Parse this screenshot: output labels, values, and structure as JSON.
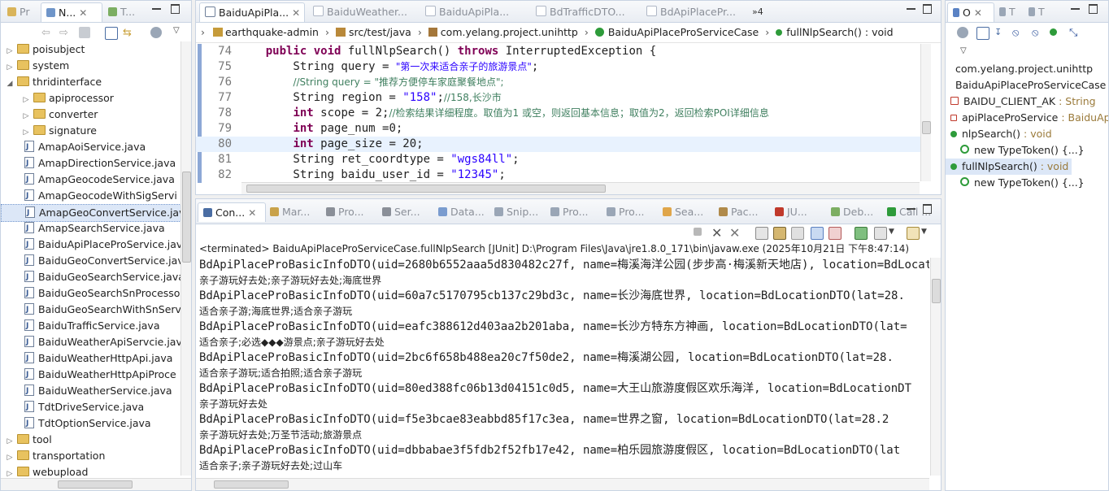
{
  "left_tabs": [
    {
      "label": "Pr",
      "active": false
    },
    {
      "label": "N...",
      "active": true
    },
    {
      "label": "T...",
      "active": false
    }
  ],
  "tree": [
    {
      "label": "poisubject",
      "kind": "folder",
      "indent": 0,
      "expanded": false
    },
    {
      "label": "system",
      "kind": "folder",
      "indent": 0,
      "expanded": false
    },
    {
      "label": "thridinterface",
      "kind": "folder",
      "indent": 0,
      "expanded": true
    },
    {
      "label": "apiprocessor",
      "kind": "folder",
      "indent": 1,
      "expanded": false
    },
    {
      "label": "converter",
      "kind": "folder",
      "indent": 1,
      "expanded": false
    },
    {
      "label": "signature",
      "kind": "folder",
      "indent": 1,
      "expanded": false
    },
    {
      "label": "AmapAoiService.java",
      "kind": "file",
      "indent": 1
    },
    {
      "label": "AmapDirectionService.java",
      "kind": "file",
      "indent": 1
    },
    {
      "label": "AmapGeocodeService.java",
      "kind": "file",
      "indent": 1
    },
    {
      "label": "AmapGeocodeWithSigServi",
      "kind": "file",
      "indent": 1
    },
    {
      "label": "AmapGeoConvertService.jav",
      "kind": "file",
      "indent": 1,
      "selected": true
    },
    {
      "label": "AmapSearchService.java",
      "kind": "file",
      "indent": 1
    },
    {
      "label": "BaiduApiPlaceProService.jav",
      "kind": "file",
      "indent": 1
    },
    {
      "label": "BaiduGeoConvertService.java",
      "kind": "file",
      "indent": 1
    },
    {
      "label": "BaiduGeoSearchService.java",
      "kind": "file",
      "indent": 1
    },
    {
      "label": "BaiduGeoSearchSnProcesso",
      "kind": "file",
      "indent": 1
    },
    {
      "label": "BaiduGeoSearchWithSnServ",
      "kind": "file",
      "indent": 1
    },
    {
      "label": "BaiduTrafficService.java",
      "kind": "file",
      "indent": 1
    },
    {
      "label": "BaiduWeatherApiServcie.java",
      "kind": "file",
      "indent": 1
    },
    {
      "label": "BaiduWeatherHttpApi.java",
      "kind": "file",
      "indent": 1
    },
    {
      "label": "BaiduWeatherHttpApiProce",
      "kind": "file",
      "indent": 1
    },
    {
      "label": "BaiduWeatherService.java",
      "kind": "file",
      "indent": 1
    },
    {
      "label": "TdtDriveService.java",
      "kind": "file",
      "indent": 1
    },
    {
      "label": "TdtOptionService.java",
      "kind": "file",
      "indent": 1
    },
    {
      "label": "tool",
      "kind": "folder",
      "indent": 0,
      "expanded": false
    },
    {
      "label": "transportation",
      "kind": "folder",
      "indent": 0,
      "expanded": false
    },
    {
      "label": "webupload",
      "kind": "folder",
      "indent": 0,
      "expanded": false
    }
  ],
  "editor_tabs": [
    {
      "label": "BaiduApiPla...",
      "active": true
    },
    {
      "label": "BaiduWeather...",
      "active": false
    },
    {
      "label": "BaiduApiPla...",
      "active": false
    },
    {
      "label": "BdTrafficDTO...",
      "active": false
    },
    {
      "label": "BdApiPlacePr...",
      "active": false
    }
  ],
  "editor_overflow": "»4",
  "breadcrumb": [
    "earthquake-admin",
    "src/test/java",
    "com.yelang.project.unihttp",
    "BaiduApiPlaceProServiceCase",
    "fullNlpSearch() : void"
  ],
  "code_lines": [
    {
      "num": "74",
      "parts": [
        {
          "t": "    "
        },
        {
          "t": "public",
          "c": "kw"
        },
        {
          "t": " "
        },
        {
          "t": "void",
          "c": "kw"
        },
        {
          "t": " fullNlpSearch() "
        },
        {
          "t": "throws",
          "c": "kw"
        },
        {
          "t": " InterruptedException {"
        }
      ]
    },
    {
      "num": "75",
      "parts": [
        {
          "t": "        String query = "
        },
        {
          "t": "\"第一次来适合亲子的旅游景点\"",
          "c": "str"
        },
        {
          "t": ";"
        }
      ]
    },
    {
      "num": "76",
      "parts": [
        {
          "t": "        "
        },
        {
          "t": "//String query = \"推荐方便停车家庭聚餐地点\";",
          "c": "cmt"
        }
      ]
    },
    {
      "num": "77",
      "parts": [
        {
          "t": "        String region = "
        },
        {
          "t": "\"158\"",
          "c": "str"
        },
        {
          "t": ";"
        },
        {
          "t": "//158,长沙市",
          "c": "cmt"
        }
      ]
    },
    {
      "num": "78",
      "parts": [
        {
          "t": "        "
        },
        {
          "t": "int",
          "c": "kw"
        },
        {
          "t": " scope = 2;"
        },
        {
          "t": "//检索结果详细程度。取值为1 或空，则返回基本信息；取值为2，返回检索POI详细信息",
          "c": "cmt"
        }
      ]
    },
    {
      "num": "79",
      "parts": [
        {
          "t": "        "
        },
        {
          "t": "int",
          "c": "kw"
        },
        {
          "t": " page_num =0;"
        }
      ]
    },
    {
      "num": "80",
      "parts": [
        {
          "t": "        "
        },
        {
          "t": "int",
          "c": "kw"
        },
        {
          "t": " page_size = 20;"
        }
      ],
      "highlight": true
    },
    {
      "num": "81",
      "parts": [
        {
          "t": "        String ret_coordtype = "
        },
        {
          "t": "\"wgs84ll\"",
          "c": "str"
        },
        {
          "t": ";"
        }
      ]
    },
    {
      "num": "82",
      "parts": [
        {
          "t": "        String baidu_user_id = "
        },
        {
          "t": "\"12345\"",
          "c": "str"
        },
        {
          "t": ";"
        }
      ]
    }
  ],
  "console_tabs": [
    {
      "label": "Con...",
      "active": true
    },
    {
      "label": "Mar...",
      "active": false
    },
    {
      "label": "Pro...",
      "active": false
    },
    {
      "label": "Ser...",
      "active": false
    },
    {
      "label": "Data...",
      "active": false
    },
    {
      "label": "Snip...",
      "active": false
    },
    {
      "label": "Pro...",
      "active": false
    },
    {
      "label": "Pro...",
      "active": false
    },
    {
      "label": "Sea...",
      "active": false
    },
    {
      "label": "Pac...",
      "active": false
    },
    {
      "label": "JU...",
      "active": false
    },
    {
      "label": "Deb...",
      "active": false
    },
    {
      "label": "Call ...",
      "active": false
    }
  ],
  "console_status": "<terminated> BaiduApiPlaceProServiceCase.fullNlpSearch [JUnit] D:\\Program Files\\Java\\jre1.8.0_171\\bin\\javaw.exe  (2025年10月21日 下午8:47:14)",
  "console_lines": [
    {
      "text": "BdApiPlaceProBasicInfoDTO(uid=2680b6552aaa5d830482c27f, name=梅溪海洋公园(步步高·梅溪新天地店), location=BdLocat",
      "cjk": false
    },
    {
      "text": "亲子游玩好去处;亲子游玩好去处;海底世界",
      "cjk": true
    },
    {
      "text": "BdApiPlaceProBasicInfoDTO(uid=60a7c5170795cb137c29bd3c, name=长沙海底世界, location=BdLocationDTO(lat=28.",
      "cjk": false
    },
    {
      "text": "适合亲子游;海底世界;适合亲子游玩",
      "cjk": true
    },
    {
      "text": "BdApiPlaceProBasicInfoDTO(uid=eafc388612d403aa2b201aba, name=长沙方特东方神画, location=BdLocationDTO(lat=",
      "cjk": false
    },
    {
      "text": "适合亲子;必选◆◆◆游景点;亲子游玩好去处",
      "cjk": true
    },
    {
      "text": "BdApiPlaceProBasicInfoDTO(uid=2bc6f658b488ea20c7f50de2, name=梅溪湖公园, location=BdLocationDTO(lat=28.",
      "cjk": false
    },
    {
      "text": "适合亲子游玩;适合拍照;适合亲子游玩",
      "cjk": true
    },
    {
      "text": "BdApiPlaceProBasicInfoDTO(uid=80ed388fc06b13d04151c0d5, name=大王山旅游度假区欢乐海洋, location=BdLocationDT",
      "cjk": false
    },
    {
      "text": "亲子游玩好去处",
      "cjk": true
    },
    {
      "text": "BdApiPlaceProBasicInfoDTO(uid=f5e3bcae83eabbd85f17c3ea, name=世界之窗, location=BdLocationDTO(lat=28.2",
      "cjk": false
    },
    {
      "text": "亲子游玩好去处;万圣节活动;旅游景点",
      "cjk": true
    },
    {
      "text": "BdApiPlaceProBasicInfoDTO(uid=dbbabae3f5fdb2f52fb17e42, name=柏乐园旅游度假区, location=BdLocationDTO(lat",
      "cjk": false
    },
    {
      "text": "适合亲子;亲子游玩好去处;过山车",
      "cjk": true
    }
  ],
  "outline_tabs": [
    {
      "label": "O",
      "active": true
    },
    {
      "label": "T",
      "active": false
    },
    {
      "label": "T",
      "active": false
    }
  ],
  "outline": [
    {
      "label": "com.yelang.project.unihttp",
      "type": "",
      "kind": "package",
      "indent": 0
    },
    {
      "label": "BaiduApiPlaceProServiceCase",
      "type": "",
      "kind": "class",
      "indent": 0
    },
    {
      "label": "BAIDU_CLIENT_AK",
      "type": " : String",
      "kind": "field-static",
      "indent": 1
    },
    {
      "label": "apiPlaceProService",
      "type": " : BaiduApi",
      "kind": "field",
      "indent": 1
    },
    {
      "label": "nlpSearch()",
      "type": " : void",
      "kind": "method",
      "indent": 1
    },
    {
      "label": "new TypeToken() {...}",
      "type": "",
      "kind": "anon",
      "indent": 2
    },
    {
      "label": "fullNlpSearch()",
      "type": " : void",
      "kind": "method",
      "indent": 1,
      "selected": true
    },
    {
      "label": "new TypeToken() {...}",
      "type": "",
      "kind": "anon",
      "indent": 2
    }
  ],
  "colors": {
    "keyword": "#7f0055",
    "string": "#2a00ff",
    "comment": "#3f7f5f",
    "method_green": "#2e9b3a",
    "field_red": "#c0392b",
    "selection": "#dce7f7"
  }
}
